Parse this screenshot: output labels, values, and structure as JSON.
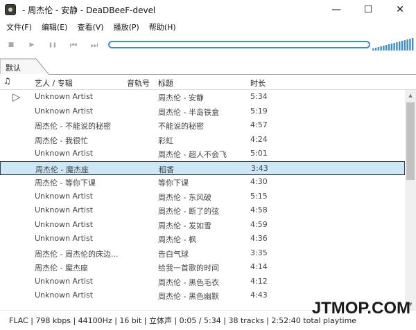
{
  "window": {
    "title": "- 周杰伦 - 安静 - DeaDBeeF-devel",
    "minimize": "—",
    "maximize": "☐",
    "close": "✕"
  },
  "menu": [
    {
      "label": "文件(F)"
    },
    {
      "label": "编辑(E)"
    },
    {
      "label": "查看(V)"
    },
    {
      "label": "播放(P)"
    },
    {
      "label": "帮助(H)"
    }
  ],
  "toolbar": {
    "icons": [
      "stop-icon",
      "play-icon",
      "pause-icon",
      "previous-icon",
      "next-icon"
    ],
    "stop": "■",
    "play": "▶",
    "pause": "❚❚",
    "prev": "⏮",
    "next": "⏭",
    "volume_level": 1.0
  },
  "tabs": [
    {
      "label": "默认"
    }
  ],
  "columns": {
    "playing": "♫",
    "artist_album": "艺人 / 专辑",
    "track_no": "音轨号",
    "title": "标题",
    "duration": "时长"
  },
  "tracks": [
    {
      "playing": "▷",
      "artist": "Unknown Artist",
      "title": "周杰伦 - 安静",
      "duration": "5:34"
    },
    {
      "playing": "",
      "artist": "Unknown Artist",
      "title": "周杰伦 - 半岛铁盒",
      "duration": "5:19"
    },
    {
      "playing": "",
      "artist": "周杰伦 - 不能说的秘密",
      "title": "不能说的秘密",
      "duration": "4:57"
    },
    {
      "playing": "",
      "artist": "周杰伦 - 我很忙",
      "title": "彩虹",
      "duration": "4:24"
    },
    {
      "playing": "",
      "artist": "Unknown Artist",
      "title": "周杰伦 - 超人不会飞",
      "duration": "5:01"
    },
    {
      "playing": "",
      "artist": "周杰伦 - 魔杰座",
      "title": "稻香",
      "duration": "3:43",
      "selected": true
    },
    {
      "playing": "",
      "artist": "周杰伦 - 等你下课",
      "title": "等你下课",
      "duration": "4:30"
    },
    {
      "playing": "",
      "artist": "Unknown Artist",
      "title": "周杰伦 - 东风破",
      "duration": "5:15"
    },
    {
      "playing": "",
      "artist": "Unknown Artist",
      "title": "周杰伦 - 断了的弦",
      "duration": "4:58"
    },
    {
      "playing": "",
      "artist": "Unknown Artist",
      "title": "周杰伦 - 发如雪",
      "duration": "4:59"
    },
    {
      "playing": "",
      "artist": "Unknown Artist",
      "title": "周杰伦 - 枫",
      "duration": "4:36"
    },
    {
      "playing": "",
      "artist": "周杰伦 - 周杰伦的床边...",
      "title": "告白气球",
      "duration": "3:35"
    },
    {
      "playing": "",
      "artist": "周杰伦 - 魔杰座",
      "title": "给我一首歌的时间",
      "duration": "4:14"
    },
    {
      "playing": "",
      "artist": "Unknown Artist",
      "title": "周杰伦 - 黑色毛衣",
      "duration": "4:12"
    },
    {
      "playing": "",
      "artist": "Unknown Artist",
      "title": "周杰伦 - 黑色幽默",
      "duration": "4:43"
    }
  ],
  "status": {
    "text": "FLAC | 798 kbps | 44100Hz | 16 bit | 立体声 | 0:05 / 5:34 | 38 tracks | 2:52:40 total playtime"
  },
  "watermark": "JTMOP.COM"
}
